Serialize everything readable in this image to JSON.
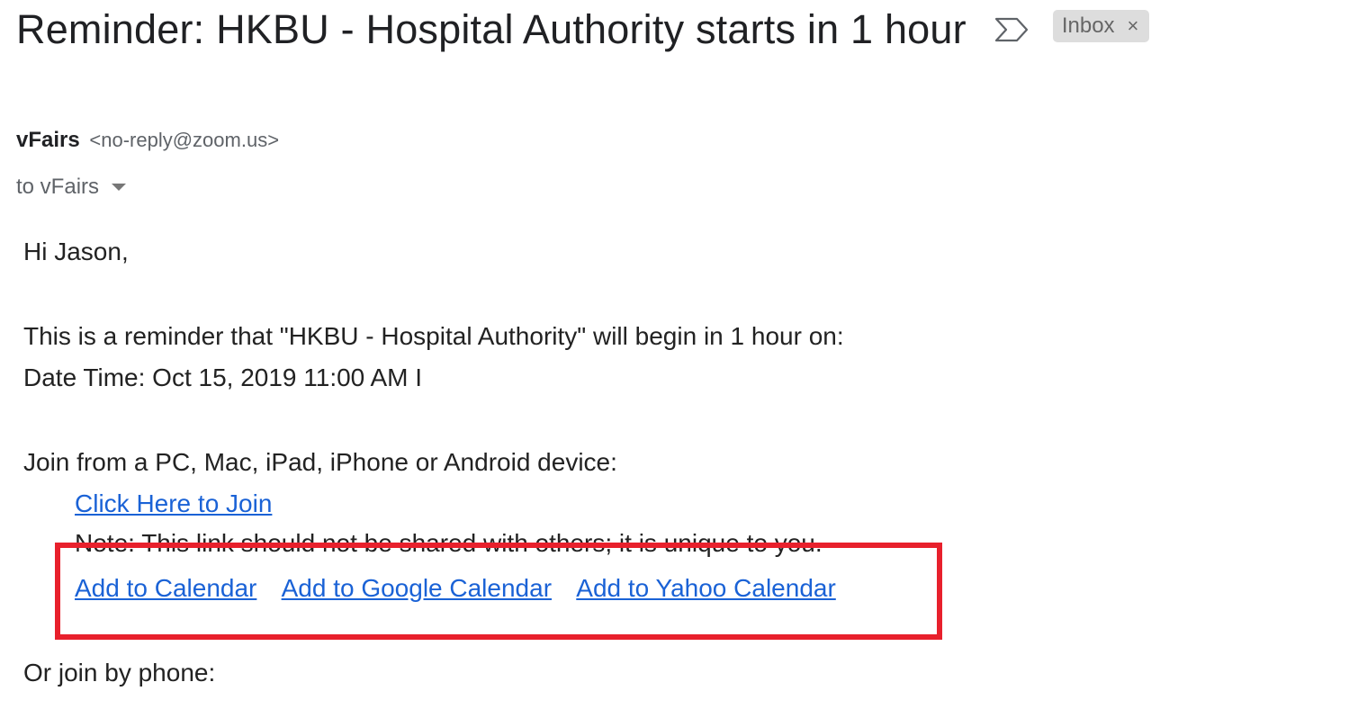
{
  "email": {
    "subject": "Reminder: HKBU - Hospital Authority starts in 1 hour",
    "label": "Inbox",
    "label_close": "×",
    "sender_name": "vFairs",
    "sender_email": "<no-reply@zoom.us>",
    "recipients": "to vFairs"
  },
  "body": {
    "greeting": "Hi Jason,",
    "reminder_text": "This is a reminder that \"HKBU - Hospital Authority\" will begin in 1 hour on:",
    "date_time": "Date Time: Oct 15, 2019 11:00 AM I",
    "join_instruction": "Join from a PC, Mac, iPad, iPhone or Android device:",
    "join_link": "Click Here to Join",
    "note": "Note: This link should not be shared with others; it is unique to you.",
    "calendar_links": [
      "Add to Calendar",
      "Add to Google Calendar",
      "Add to Yahoo Calendar"
    ],
    "phone_intro": "Or join by phone:"
  },
  "colors": {
    "link": "#1a62d6",
    "highlight": "#e8202c",
    "chip_background": "#dddddd"
  },
  "icons": [
    "importance-marker-icon",
    "close-icon",
    "dropdown-caret-icon"
  ]
}
